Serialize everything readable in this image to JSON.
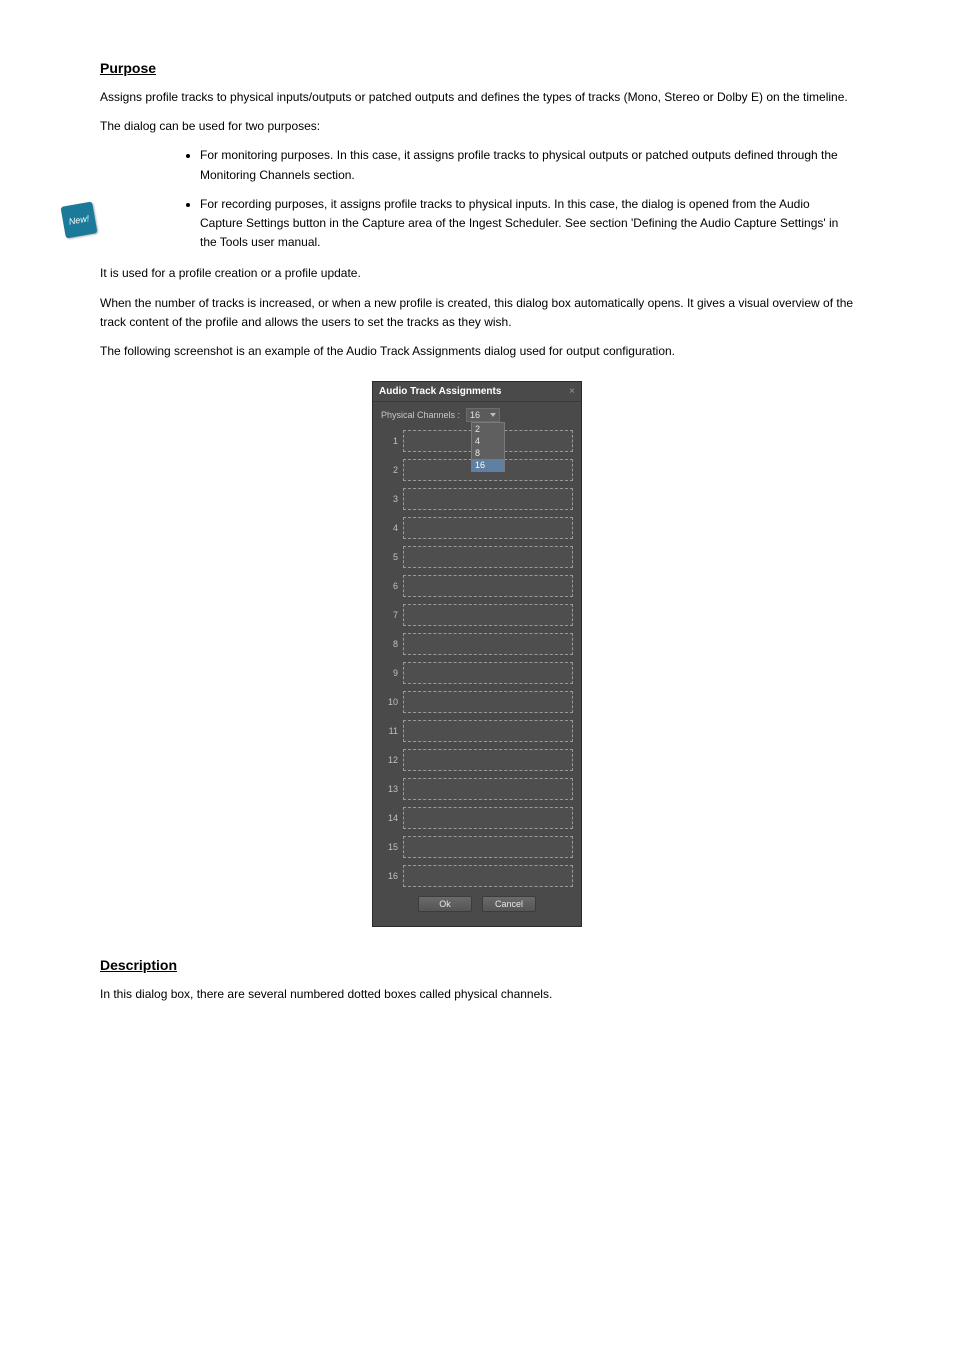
{
  "badge": {
    "label": "New!"
  },
  "section1": {
    "heading": "Purpose",
    "p1": "Assigns profile tracks to physical inputs/outputs or patched outputs and defines the types of tracks (Mono, Stereo or Dolby E) on the timeline.",
    "p2": "The dialog can be used for two purposes:",
    "bullets": [
      "For monitoring purposes. In this case, it assigns profile tracks to physical outputs or patched outputs defined through the Monitoring Channels section.",
      "For recording purposes, it assigns profile tracks to physical inputs. In this case, the dialog is opened from the Audio Capture Settings button in the Capture area of the Ingest Scheduler. See section 'Defining the Audio Capture Settings' in the Tools user manual."
    ],
    "p3": "It is used for a profile creation or a profile update.",
    "p4": "When the number of tracks is increased, or when a new profile is created, this dialog box automatically opens. It gives a visual overview of the track content of the profile and allows the users to set the tracks as they wish.",
    "p5": "The following screenshot is an example of the Audio Track Assignments dialog used for output configuration."
  },
  "dialog": {
    "title": "Audio Track Assignments",
    "physical_channels_label": "Physical Channels :",
    "selected": "16",
    "options": [
      "2",
      "4",
      "8",
      "16"
    ],
    "rows": [
      "1",
      "2",
      "3",
      "4",
      "5",
      "6",
      "7",
      "8",
      "9",
      "10",
      "11",
      "12",
      "13",
      "14",
      "15",
      "16"
    ],
    "ok": "Ok",
    "cancel": "Cancel"
  },
  "section2": {
    "heading": "Description",
    "p1": "In this dialog box, there are several numbered dotted boxes called physical channels."
  }
}
